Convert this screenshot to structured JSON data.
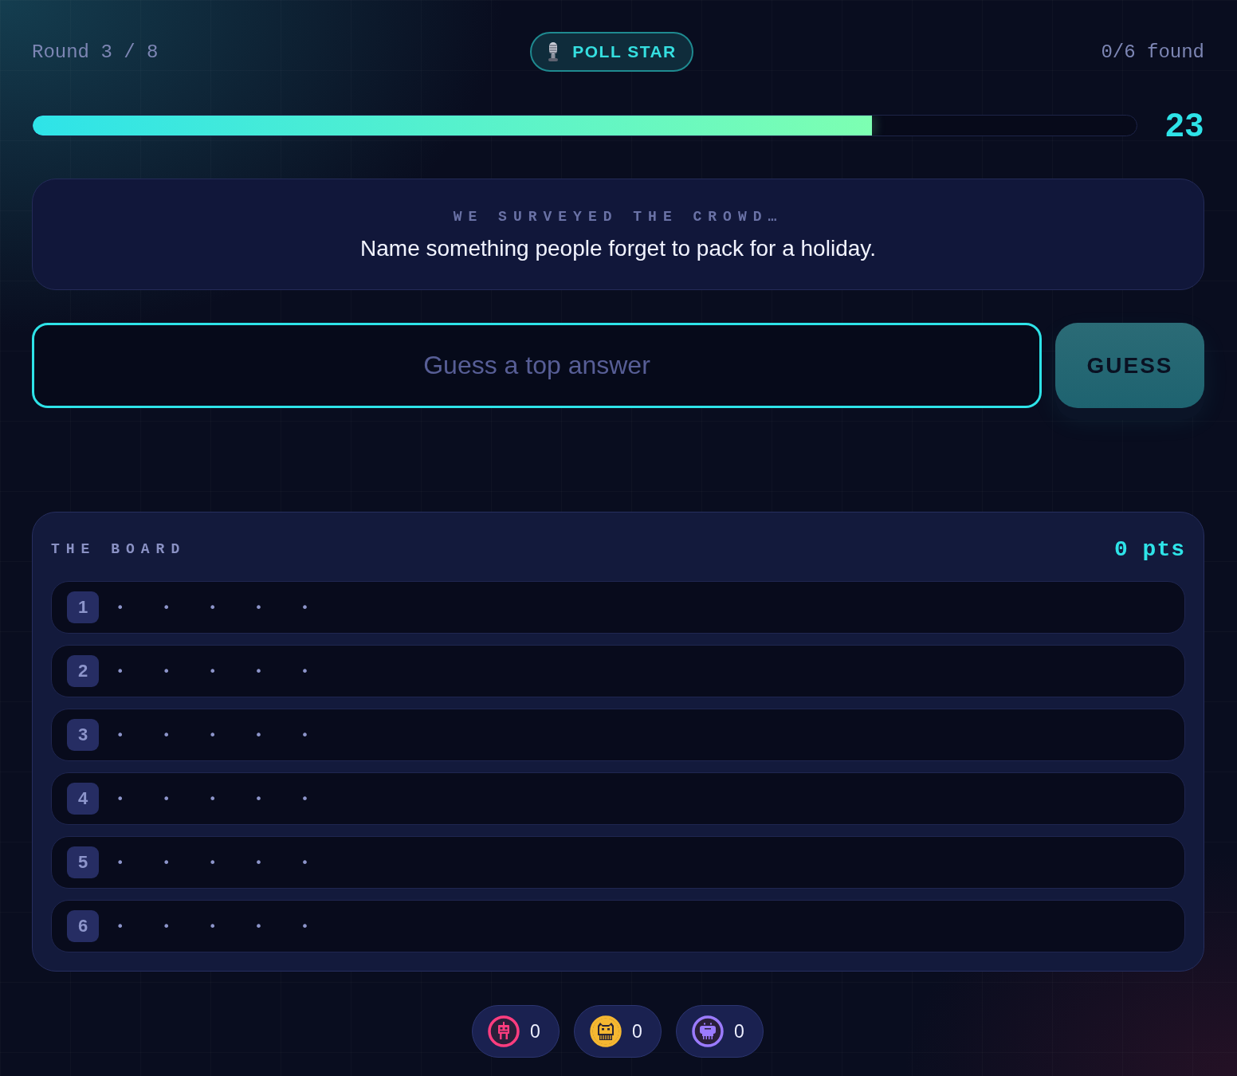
{
  "header": {
    "round": "Round 3 / 8",
    "badge": "POLL STAR",
    "found": "0/6 found"
  },
  "timer": {
    "level": 0.76,
    "seconds": "23"
  },
  "prompt": {
    "eyebrow": "WE SURVEYED THE CROWD…",
    "question": "Name something people forget to pack for a holiday."
  },
  "guess": {
    "placeholder": "Guess a top answer",
    "button": "GUESS"
  },
  "board": {
    "title": "THE BOARD",
    "points": "0 pts",
    "answers": [
      {
        "number": "1",
        "mask": "•••••"
      },
      {
        "number": "2",
        "mask": "•••••"
      },
      {
        "number": "3",
        "mask": "•••••"
      },
      {
        "number": "4",
        "mask": "•••••"
      },
      {
        "number": "5",
        "mask": "•••••"
      },
      {
        "number": "6",
        "mask": "•••••"
      }
    ]
  },
  "players": [
    {
      "kind": "robot",
      "color": "#ff3d7f",
      "score": "0"
    },
    {
      "kind": "cat",
      "color": "#f5b731",
      "score": "0"
    },
    {
      "kind": "invader",
      "color": "#9b7bff",
      "score": "0"
    }
  ]
}
